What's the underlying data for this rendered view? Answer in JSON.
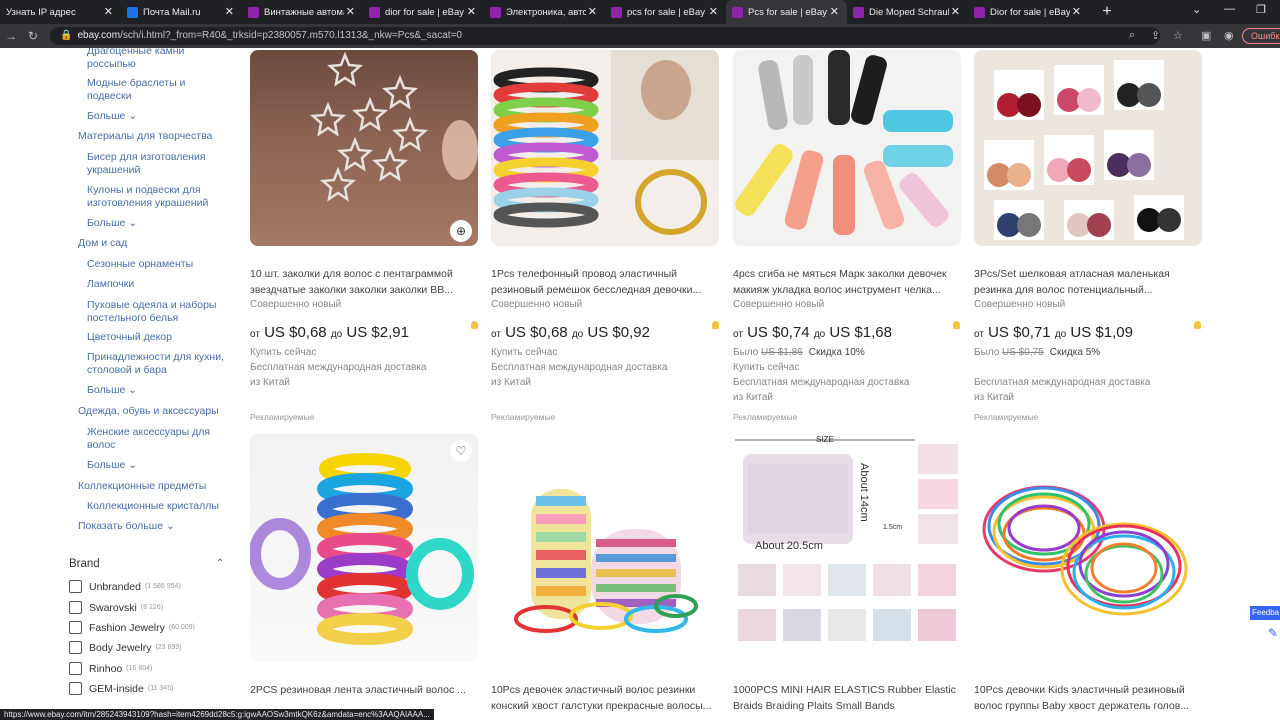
{
  "browser": {
    "tabs": [
      {
        "title": "Узнать IP адрес",
        "color": "#202124"
      },
      {
        "title": "Почта Mail.ru",
        "color": "#1a73e8"
      },
      {
        "title": "Винтажные автоматы",
        "color": "#8e24aa"
      },
      {
        "title": "dior for sale | eBay",
        "color": "#8e24aa"
      },
      {
        "title": "Электроника, автомо",
        "color": "#8e24aa"
      },
      {
        "title": "pcs for sale | eBay",
        "color": "#8e24aa"
      },
      {
        "title": "Pcs for sale | eBay",
        "color": "#8e24aa"
      },
      {
        "title": "Die Moped Schrauber",
        "color": "#8e24aa"
      },
      {
        "title": "Dior for sale | eBay",
        "color": "#8e24aa"
      }
    ],
    "new_tab": "+",
    "url_host": "ebay.com",
    "url_path": "/sch/i.html?_from=R40&_trksid=p2380057.m570.l1313&_nkw=Pcs&_sacat=0",
    "error_button": "Ошибка",
    "status_url": "https://www.ebay.com/itm/285243943109?hash=item4269dd28c5:g:igwAAOSw3mtkQK6z&amdata=enc%3AAQAIAAA..."
  },
  "sidebar": {
    "categories": [
      {
        "label": "Драгоценные камни россыпью",
        "level": 2
      },
      {
        "label": "Модные браслеты и подвески",
        "level": 2
      },
      {
        "label": "Больше ⌄",
        "level": 2
      },
      {
        "label": "Материалы для творчества",
        "level": 1
      },
      {
        "label": "Бисер для изготовления украшений",
        "level": 2
      },
      {
        "label": "Кулоны и подвески для изготовления украшений",
        "level": 2
      },
      {
        "label": "Больше ⌄",
        "level": 2
      },
      {
        "label": "Дом и сад",
        "level": 1
      },
      {
        "label": "Сезонные орнаменты",
        "level": 2
      },
      {
        "label": "Лампочки",
        "level": 2
      },
      {
        "label": "Пуховые одеяла и наборы постельного белья",
        "level": 2
      },
      {
        "label": "Цветочный декор",
        "level": 2
      },
      {
        "label": "Принадлежности для кухни, столовой и бара",
        "level": 2
      },
      {
        "label": "Больше ⌄",
        "level": 2
      },
      {
        "label": "Одежда, обувь и аксессуары",
        "level": 1
      },
      {
        "label": "Женские аксессуары для волос",
        "level": 2
      },
      {
        "label": "Больше ⌄",
        "level": 2
      },
      {
        "label": "Коллекционные предметы",
        "level": 1
      },
      {
        "label": "Коллекционные кристаллы",
        "level": 2
      },
      {
        "label": "Показать больше ⌄",
        "level": 1
      }
    ],
    "brand": {
      "title": "Brand",
      "items": [
        {
          "label": "Unbranded",
          "count": "(1 586 954)"
        },
        {
          "label": "Swarovski",
          "count": "(6 226)"
        },
        {
          "label": "Fashion Jewelry",
          "count": "(60 009)"
        },
        {
          "label": "Body Jewelry",
          "count": "(23 699)"
        },
        {
          "label": "Rinhoo",
          "count": "(16 804)"
        },
        {
          "label": "GEM-inside",
          "count": "(11 345)"
        }
      ]
    }
  },
  "products": [
    {
      "title": "10 шт. заколки для волос с пентаграммой звездчатые заколки заколки заколки BB...",
      "condition": "Совершенно новый",
      "price_from": "от",
      "price_low": "US $0,68",
      "price_to": "до",
      "price_high": "US $2,91",
      "was_label": "",
      "was_price": "",
      "discount": "",
      "buy": "",
      "shipping": "",
      "origin": "",
      "sponsored": "Рекламируемые"
    },
    {
      "title": "1Pcs телефонный провод эластичный резиновый ремешок бесследная девочки...",
      "condition": "Совершенно новый",
      "price_from": "от",
      "price_low": "US $0,68",
      "price_to": "до",
      "price_high": "US $0,92",
      "was_label": "",
      "was_price": "",
      "discount": "",
      "buy": "Купить сейчас",
      "shipping": "Бесплатная международная доставка",
      "origin": "из Китай",
      "sponsored": "Рекламируемые"
    },
    {
      "title": "4pcs сгиба не мяться Марк заколки девочек макияж укладка волос инструмент челка...",
      "condition": "Совершенно новый",
      "price_from": "от",
      "price_low": "US $0,74",
      "price_to": "до",
      "price_high": "US $1,68",
      "was_label": "Было",
      "was_price": "US $1,86",
      "discount": "Скидка 10%",
      "buy": "Купить сейчас",
      "shipping": "Бесплатная международная доставка",
      "origin": "из Китай",
      "sponsored": "Рекламируемые"
    },
    {
      "title": "3Pcs/Set шелковая атласная маленькая резинка для волос потенциальный...",
      "condition": "Совершенно новый",
      "price_from": "от",
      "price_low": "US $0,71",
      "price_to": "до",
      "price_high": "US $1,09",
      "was_label": "Было",
      "was_price": "US $0,75",
      "discount": "Скидка 5%",
      "buy": "",
      "shipping": "Бесплатная международная доставка",
      "origin": "из Китай",
      "sponsored": "Рекламируемые"
    },
    {
      "title": "2PCS резиновая лента эластичный волос ..."
    },
    {
      "title": "10Pcs девочек эластичный волос резинки конский хвост галстуки прекрасные волосы..."
    },
    {
      "title": "1000PCS MINI HAIR ELASTICS Rubber Elastic Braids Braiding Plaits Small Bands"
    },
    {
      "title": "10Pcs девочки Kids эластичный резиновый волос группы Baby хвост держатель голов..."
    }
  ],
  "first_product_buy": "Купить сейчас",
  "image_text": {
    "size": "SIZE",
    "about_h": "About 14cm",
    "about_w": "About 20.5cm",
    "small": "1.5cm"
  },
  "feedback": "Feedba",
  "colors": {
    "link": "#4a6fa5",
    "accent": "#3665f3",
    "bulb": "#f4c542"
  }
}
